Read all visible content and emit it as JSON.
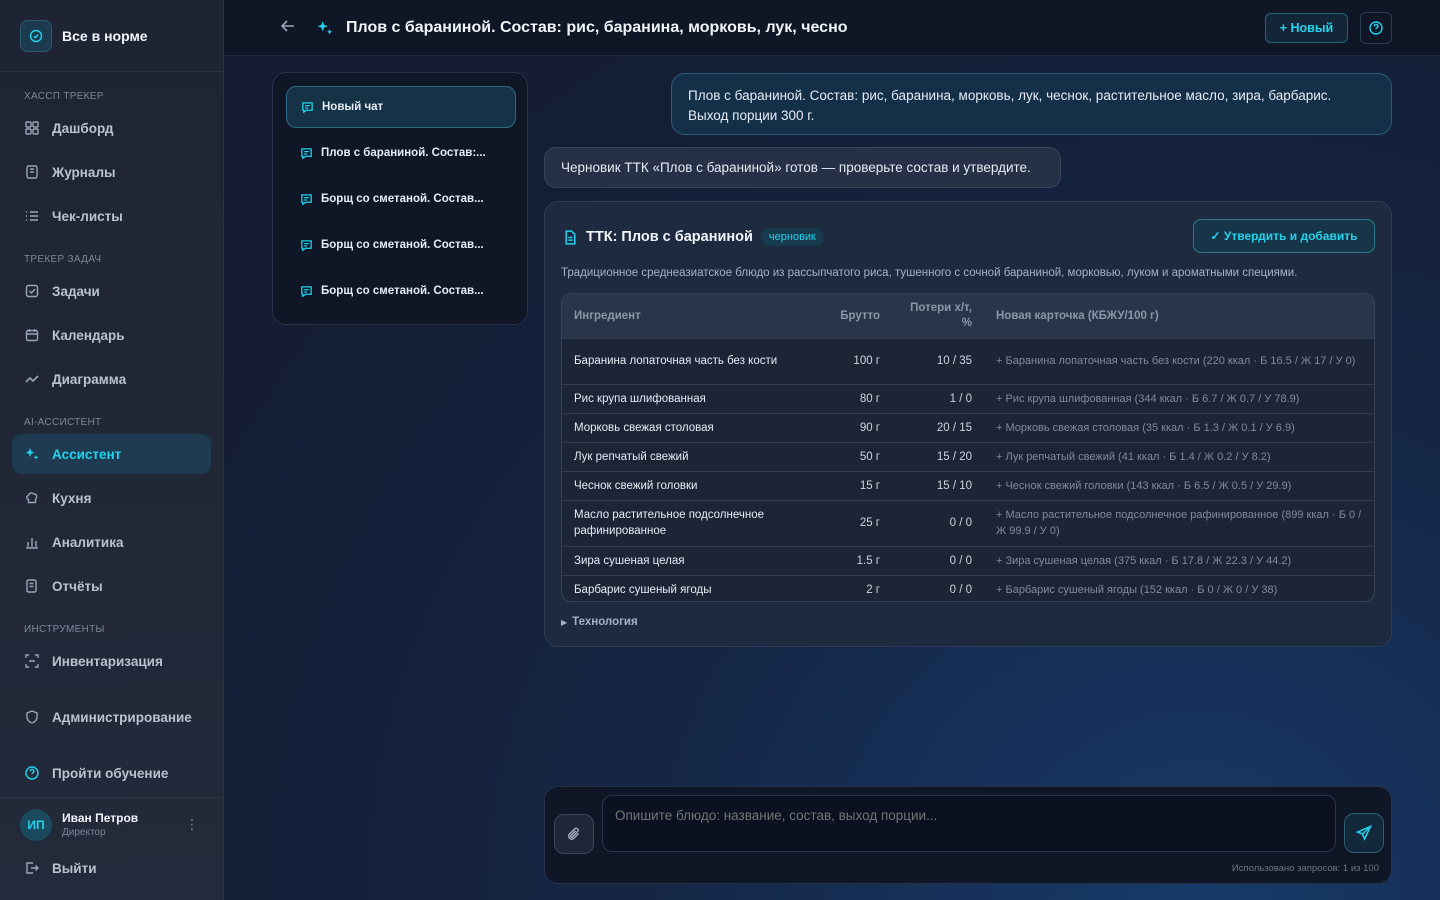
{
  "brand": {
    "status": "Все в норме"
  },
  "sidebar": {
    "sections": [
      {
        "title": "ХАССП ТРЕКЕР"
      },
      {
        "title": "ТРЕКЕР ЗАДАЧ"
      },
      {
        "title": "AI-АССИСТЕНТ"
      },
      {
        "title": "ИНСТРУМЕНТЫ"
      }
    ],
    "items": [
      {
        "label": "Дашборд",
        "icon": "dashboard-icon"
      },
      {
        "label": "Журналы",
        "icon": "journal-icon"
      },
      {
        "label": "Чек-листы",
        "icon": "checklist-icon"
      },
      {
        "label": "Задачи",
        "icon": "task-icon"
      },
      {
        "label": "Календарь",
        "icon": "calendar-icon"
      },
      {
        "label": "Диаграмма",
        "icon": "chart-line-icon"
      },
      {
        "label": "Ассистент",
        "icon": "sparkle-icon",
        "active": true
      },
      {
        "label": "Кухня",
        "icon": "chef-hat-icon"
      },
      {
        "label": "Аналитика",
        "icon": "bar-chart-icon"
      },
      {
        "label": "Отчёты",
        "icon": "report-icon"
      },
      {
        "label": "Инвентаризация",
        "icon": "scan-icon"
      },
      {
        "label": "Администрирование",
        "icon": "shield-icon"
      },
      {
        "label": "Пройти обучение",
        "icon": "help-icon"
      }
    ],
    "user": {
      "initials": "ИП",
      "name": "Иван Петров",
      "role": "Директор"
    },
    "logout": "Выйти"
  },
  "header": {
    "title": "Плов с бараниной. Состав: рис, баранина, морковь, лук, чесно",
    "new_label": "+ Новый"
  },
  "chats": [
    {
      "label": "Новый чат",
      "active": true
    },
    {
      "label": "Плов с бараниной. Состав:..."
    },
    {
      "label": "Борщ со сметаной. Состав..."
    },
    {
      "label": "Борщ со сметаной. Состав..."
    },
    {
      "label": "Борщ со сметаной. Состав..."
    }
  ],
  "messages": {
    "user": "Плов с бараниной. Состав: рис, баранина, морковь, лук, чеснок, растительное масло, зира, барбарис. Выход порции 300 г.",
    "bot": "Черновик ТТК «Плов с бараниной» готов — проверьте состав и утвердите."
  },
  "ttk": {
    "title": "ТТК: Плов с бараниной",
    "badge": "черновик",
    "approve_label": "✓ Утвердить и добавить",
    "description": "Традиционное среднеазиатское блюдо из рассыпчатого риса, тушенного с сочной бараниной, морковью, луком и ароматными специями.",
    "columns": [
      "Ингредиент",
      "Брутто",
      "Потери х/т, %",
      "Новая карточка (КБЖУ/100 г)"
    ],
    "rows": [
      {
        "name": "Баранина лопаточная часть без кости",
        "gross": "100 г",
        "loss": "10 / 35",
        "card": "+ Баранина лопаточная часть без кости (220 ккал · Б 16.5 / Ж 17 / У 0)"
      },
      {
        "name": "Рис крупа шлифованная",
        "gross": "80 г",
        "loss": "1 / 0",
        "card": "+ Рис крупа шлифованная (344 ккал · Б 6.7 / Ж 0.7 / У 78.9)"
      },
      {
        "name": "Морковь свежая столовая",
        "gross": "90 г",
        "loss": "20 / 15",
        "card": "+ Морковь свежая столовая (35 ккал · Б 1.3 / Ж 0.1 / У 6.9)"
      },
      {
        "name": "Лук репчатый свежий",
        "gross": "50 г",
        "loss": "15 / 20",
        "card": "+ Лук репчатый свежий (41 ккал · Б 1.4 / Ж 0.2 / У 8.2)"
      },
      {
        "name": "Чеснок свежий головки",
        "gross": "15 г",
        "loss": "15 / 10",
        "card": "+ Чеснок свежий головки (143 ккал · Б 6.5 / Ж 0.5 / У 29.9)"
      },
      {
        "name": "Масло растительное подсолнечное рафинированное",
        "gross": "25 г",
        "loss": "0 / 0",
        "card": "+ Масло растительное подсолнечное рафинированное (899 ккал · Б 0 / Ж 99.9 / У 0)"
      },
      {
        "name": "Зира сушеная целая",
        "gross": "1.5 г",
        "loss": "0 / 0",
        "card": "+ Зира сушеная целая (375 ккал · Б 17.8 / Ж 22.3 / У 44.2)"
      },
      {
        "name": "Барбарис сушеный ягоды",
        "gross": "2 г",
        "loss": "0 / 0",
        "card": "+ Барбарис сушеный ягоды (152 ккал · Б 0 / Ж 0 / У 38)"
      }
    ],
    "technology_label": "Технология"
  },
  "composer": {
    "placeholder": "Опишите блюдо: название, состав, выход порции...",
    "usage": "Использовано запросов: 1 из 100"
  },
  "colors": {
    "accent": "#22d3ee",
    "sidebar_bg": "#1e2433",
    "card_bg": "#1e2a40"
  }
}
